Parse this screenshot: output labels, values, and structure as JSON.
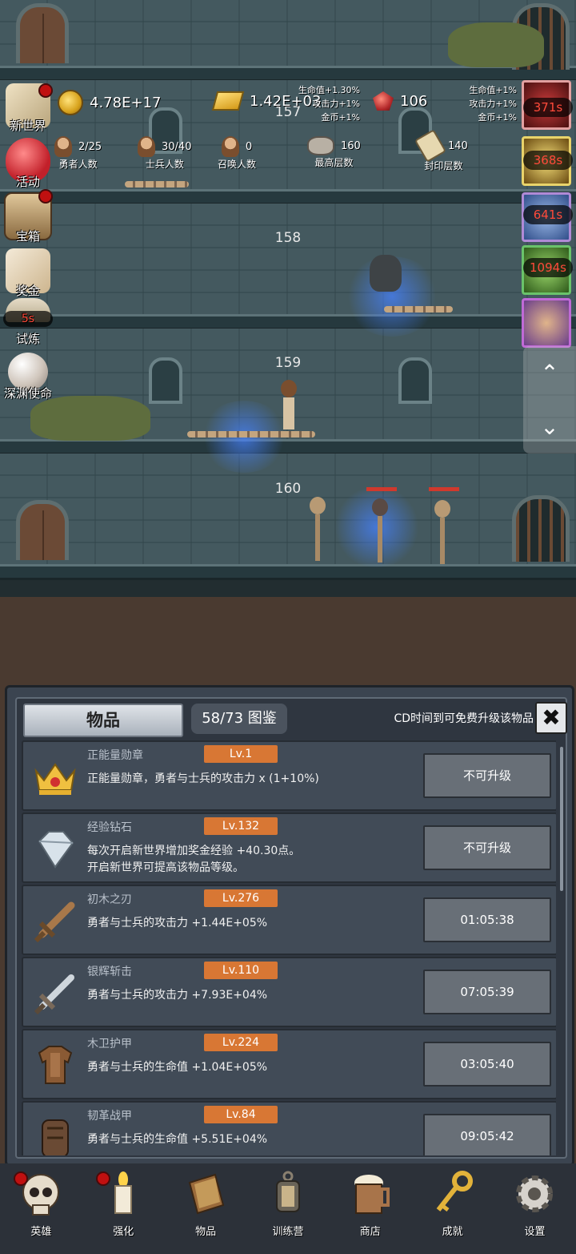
{
  "resources": {
    "gold": "4.78E+17",
    "gold_bars": "1.42E+03",
    "gems": "106",
    "bonus_left": [
      "生命值+1.30%",
      "攻击力+1%",
      "金币+1%"
    ],
    "bonus_right": [
      "生命值+1%",
      "攻击力+1%",
      "金币+1%"
    ]
  },
  "stats": {
    "heroes": {
      "value": "2/25",
      "label": "勇者人数"
    },
    "soldiers": {
      "value": "30/40",
      "label": "士兵人数"
    },
    "summons": {
      "value": "0",
      "label": "召唤人数"
    },
    "max_floor": {
      "value": "160",
      "label": "最高层数"
    },
    "seal_floor": {
      "value": "140",
      "label": "封印层数"
    }
  },
  "floors": [
    "157",
    "158",
    "159",
    "160"
  ],
  "side_menu": [
    {
      "label": "新世界",
      "icon": "map-icon",
      "dot": true
    },
    {
      "label": "活动",
      "icon": "heart-icon",
      "dot": false
    },
    {
      "label": "宝箱",
      "icon": "chest-icon",
      "dot": true
    },
    {
      "label": "奖金",
      "icon": "envelope-icon",
      "dot": false
    },
    {
      "label": "试炼",
      "icon": "trial-icon",
      "dot": false,
      "timer": "5s"
    },
    {
      "label": "深渊使命",
      "icon": "pearl-icon",
      "dot": false
    }
  ],
  "right_timers": [
    "371s",
    "368s",
    "641s",
    "1094s"
  ],
  "scroll_controls": {
    "up": "⌃",
    "down": "⌄"
  },
  "panel": {
    "tab": "物品",
    "codex": "58/73 图鉴",
    "note": "CD时间到可免费升级该物品",
    "close": "✖",
    "items": [
      {
        "name": "正能量勋章",
        "level": "Lv.1",
        "desc1": "正能量勋章，勇者与士兵的攻击力 x (1+10%)",
        "desc2": "",
        "button": "不可升级",
        "icon": "crown-icon"
      },
      {
        "name": "经验钻石",
        "level": "Lv.132",
        "desc1": "每次开启新世界增加奖金经验 +40.30点。",
        "desc2": "开启新世界可提高该物品等级。",
        "button": "不可升级",
        "icon": "diamond-icon"
      },
      {
        "name": "初木之刃",
        "level": "Lv.276",
        "desc1": "勇者与士兵的攻击力 +1.44E+05%",
        "desc2": "",
        "button": "01:05:38",
        "icon": "wooden-sword-icon"
      },
      {
        "name": "银辉斩击",
        "level": "Lv.110",
        "desc1": "勇者与士兵的攻击力 +7.93E+04%",
        "desc2": "",
        "button": "07:05:39",
        "icon": "silver-sword-icon"
      },
      {
        "name": "木卫护甲",
        "level": "Lv.224",
        "desc1": "勇者与士兵的生命值 +1.04E+05%",
        "desc2": "",
        "button": "03:05:40",
        "icon": "wooden-armor-icon"
      },
      {
        "name": "韧革战甲",
        "level": "Lv.84",
        "desc1": "勇者与士兵的生命值 +5.51E+04%",
        "desc2": "",
        "button": "09:05:42",
        "icon": "leather-armor-icon"
      }
    ]
  },
  "nav": [
    {
      "label": "英雄",
      "icon": "skull-icon",
      "dot": true
    },
    {
      "label": "强化",
      "icon": "candle-icon",
      "dot": true
    },
    {
      "label": "物品",
      "icon": "book-icon",
      "dot": false
    },
    {
      "label": "训练营",
      "icon": "lantern-icon",
      "dot": false
    },
    {
      "label": "商店",
      "icon": "mug-icon",
      "dot": false
    },
    {
      "label": "成就",
      "icon": "key-icon",
      "dot": false
    },
    {
      "label": "设置",
      "icon": "gear-icon",
      "dot": false
    }
  ]
}
